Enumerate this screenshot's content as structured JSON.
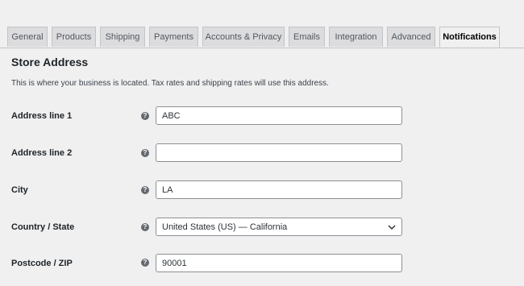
{
  "tabs": [
    {
      "label": "General"
    },
    {
      "label": "Products"
    },
    {
      "label": "Shipping"
    },
    {
      "label": "Payments"
    },
    {
      "label": "Accounts & Privacy"
    },
    {
      "label": "Emails"
    },
    {
      "label": "Integration"
    },
    {
      "label": "Advanced"
    },
    {
      "label": "Notifications"
    }
  ],
  "section": {
    "title": "Store Address",
    "description": "This is where your business is located. Tax rates and shipping rates will use this address."
  },
  "fields": {
    "address1": {
      "label": "Address line 1",
      "value": "ABC"
    },
    "address2": {
      "label": "Address line 2",
      "value": ""
    },
    "city": {
      "label": "City",
      "value": "LA"
    },
    "country": {
      "label": "Country / State",
      "value": "United States (US) — California"
    },
    "postcode": {
      "label": "Postcode / ZIP",
      "value": "90001"
    }
  },
  "icons": {
    "help": "help-icon",
    "help_glyph": "?",
    "dropdown": "chevron-down-icon"
  },
  "colors": {
    "background": "#f0f0f1",
    "tab_inactive": "#dcdcde",
    "border": "#c3c4c7",
    "input_border": "#8c8f94",
    "help_icon": "#646970"
  }
}
